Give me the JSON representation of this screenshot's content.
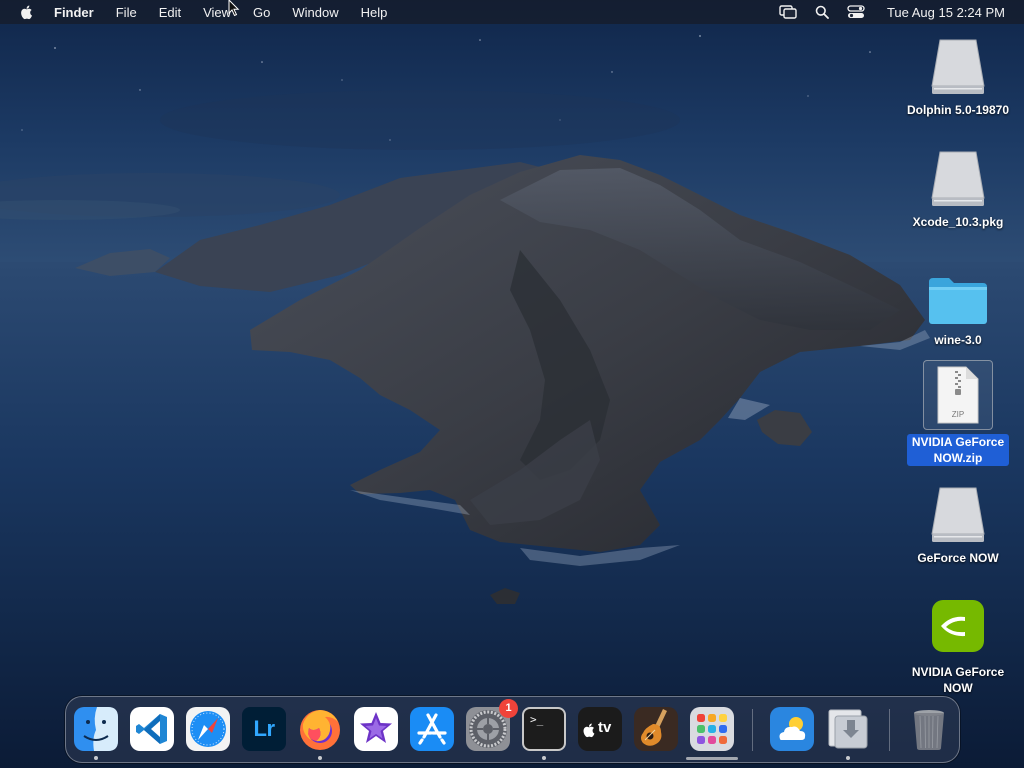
{
  "menubar": {
    "app_name": "Finder",
    "menus": [
      "File",
      "Edit",
      "View",
      "Go",
      "Window",
      "Help"
    ],
    "clock": "Tue Aug 15  2:24 PM",
    "status_icons": [
      "screen-mirroring-icon",
      "spotlight-search-icon",
      "control-center-icon"
    ]
  },
  "desktop": {
    "icons": [
      {
        "label": "Dolphin 5.0-19870",
        "kind": "disk-image-icon"
      },
      {
        "label": "Xcode_10.3.pkg",
        "kind": "disk-image-icon"
      },
      {
        "label": "wine-3.0",
        "kind": "folder-icon"
      },
      {
        "label": "NVIDIA GeForce NOW.zip",
        "kind": "zip-file-icon",
        "zip_text": "ZIP",
        "selected": true
      },
      {
        "label": "GeForce NOW",
        "kind": "disk-image-icon"
      },
      {
        "label": "NVIDIA GeForce NOW",
        "kind": "nvidia-app-icon"
      }
    ]
  },
  "dock": {
    "apps": [
      {
        "name": "Finder",
        "icon": "finder-icon",
        "running": true
      },
      {
        "name": "Visual Studio Code",
        "icon": "vscode-icon",
        "running": false
      },
      {
        "name": "Safari",
        "icon": "safari-icon",
        "running": false
      },
      {
        "name": "Lightroom",
        "icon": "lightroom-icon",
        "label": "Lr",
        "running": false
      },
      {
        "name": "Firefox",
        "icon": "firefox-icon",
        "running": true
      },
      {
        "name": "iMovie",
        "icon": "imovie-icon",
        "running": false
      },
      {
        "name": "App Store",
        "icon": "app-store-icon",
        "running": false
      },
      {
        "name": "System Preferences",
        "icon": "system-preferences-icon",
        "badge": "1",
        "running": false
      },
      {
        "name": "Terminal",
        "icon": "terminal-icon",
        "label": ">_",
        "running": true
      },
      {
        "name": "Apple TV",
        "icon": "apple-tv-icon",
        "label": "tv",
        "running": false
      },
      {
        "name": "GarageBand",
        "icon": "garageband-icon",
        "running": false
      },
      {
        "name": "Launchpad",
        "icon": "launchpad-icon",
        "running": false
      },
      {
        "name": "Weather",
        "icon": "weather-icon",
        "running": false
      },
      {
        "name": "Downloads",
        "icon": "downloads-stack-icon",
        "running": true
      },
      {
        "name": "Trash",
        "icon": "trash-icon",
        "running": false
      }
    ]
  },
  "colors": {
    "selection": "#1f5fd6",
    "badge": "#f0433a",
    "nvidia_green": "#76b900"
  }
}
